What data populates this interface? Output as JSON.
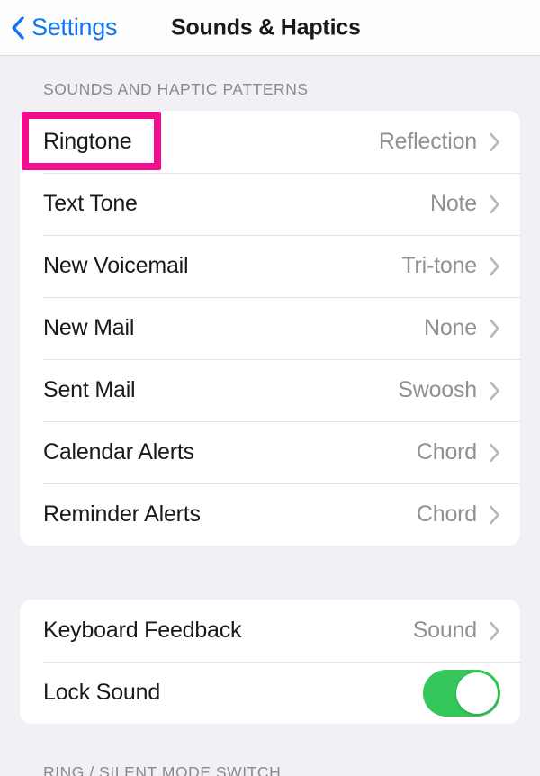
{
  "navbar": {
    "back_label": "Settings",
    "back_icon": "chevron-left-icon",
    "title": "Sounds & Haptics"
  },
  "sections": [
    {
      "header": "SOUNDS AND HAPTIC PATTERNS",
      "rows": [
        {
          "label": "Ringtone",
          "value": "Reflection",
          "accessory": "disclosure-chevron-icon"
        },
        {
          "label": "Text Tone",
          "value": "Note",
          "accessory": "disclosure-chevron-icon"
        },
        {
          "label": "New Voicemail",
          "value": "Tri-tone",
          "accessory": "disclosure-chevron-icon"
        },
        {
          "label": "New Mail",
          "value": "None",
          "accessory": "disclosure-chevron-icon"
        },
        {
          "label": "Sent Mail",
          "value": "Swoosh",
          "accessory": "disclosure-chevron-icon"
        },
        {
          "label": "Calendar Alerts",
          "value": "Chord",
          "accessory": "disclosure-chevron-icon"
        },
        {
          "label": "Reminder Alerts",
          "value": "Chord",
          "accessory": "disclosure-chevron-icon"
        }
      ]
    },
    {
      "header": "",
      "rows": [
        {
          "label": "Keyboard Feedback",
          "value": "Sound",
          "accessory": "disclosure-chevron-icon"
        },
        {
          "label": "Lock Sound",
          "value": "",
          "accessory": "toggle-switch",
          "toggle_on": true
        }
      ]
    },
    {
      "header": "RING / SILENT MODE SWITCH",
      "rows": []
    }
  ],
  "annotation": {
    "target": "Ringtone",
    "color": "#F20D8C"
  },
  "colors": {
    "accent_blue": "#1275F0",
    "toggle_green": "#34C759",
    "value_gray": "#909095",
    "header_gray": "#8A8A8E",
    "page_background": "#F1F1F5",
    "card_background": "#FFFFFF",
    "highlight_pink": "#F20D8C"
  }
}
